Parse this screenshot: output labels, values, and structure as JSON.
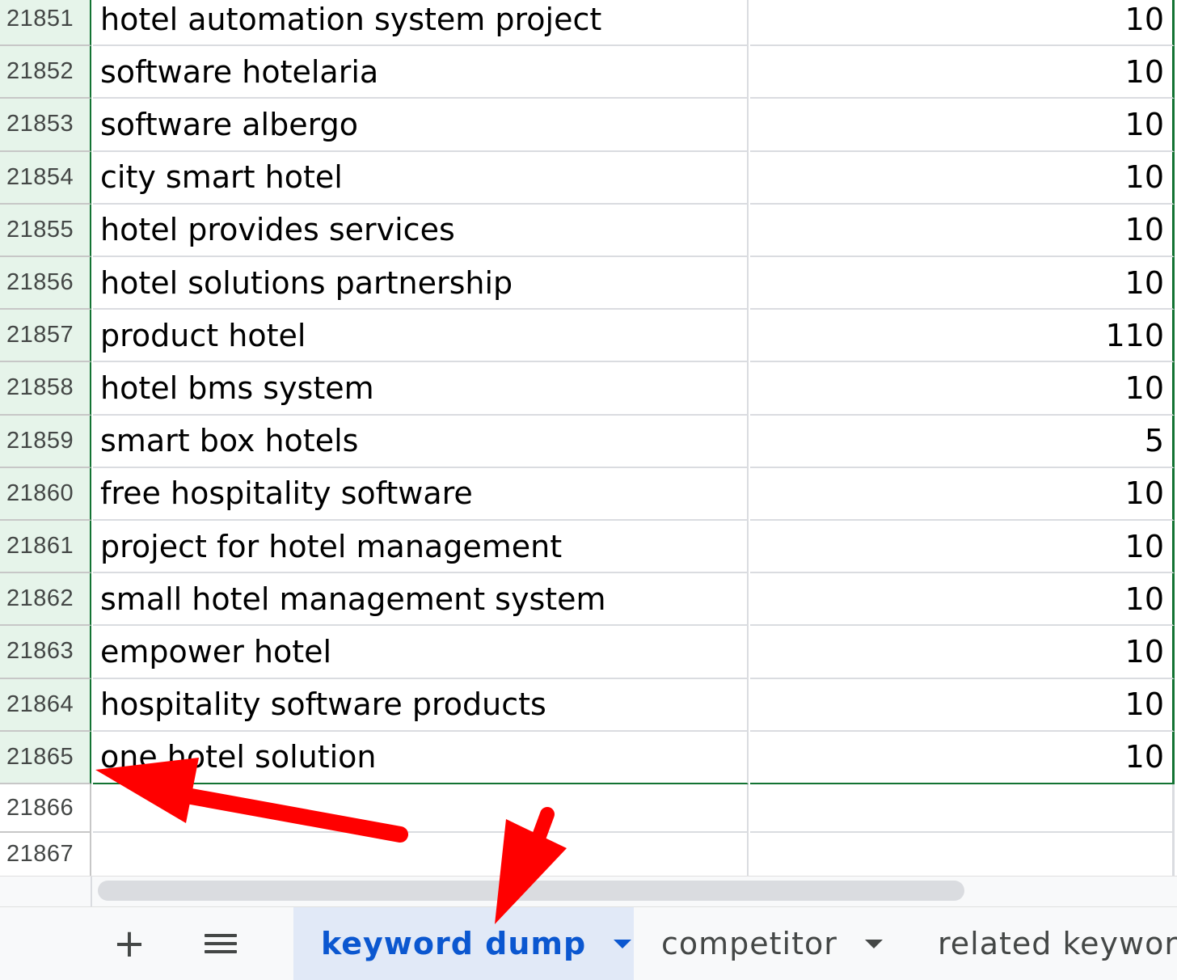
{
  "rows": [
    {
      "num": "21851",
      "keyword": "hotel automation system project",
      "value": "10"
    },
    {
      "num": "21852",
      "keyword": "software hotelaria",
      "value": "10"
    },
    {
      "num": "21853",
      "keyword": "software albergo",
      "value": "10"
    },
    {
      "num": "21854",
      "keyword": "city smart hotel",
      "value": "10"
    },
    {
      "num": "21855",
      "keyword": "hotel provides services",
      "value": "10"
    },
    {
      "num": "21856",
      "keyword": "hotel solutions partnership",
      "value": "10"
    },
    {
      "num": "21857",
      "keyword": "product hotel",
      "value": "110"
    },
    {
      "num": "21858",
      "keyword": "hotel bms system",
      "value": "10"
    },
    {
      "num": "21859",
      "keyword": "smart box hotels",
      "value": "5"
    },
    {
      "num": "21860",
      "keyword": "free hospitality software",
      "value": "10"
    },
    {
      "num": "21861",
      "keyword": "project for hotel management",
      "value": "10"
    },
    {
      "num": "21862",
      "keyword": "small hotel management system",
      "value": "10"
    },
    {
      "num": "21863",
      "keyword": "empower hotel",
      "value": "10"
    },
    {
      "num": "21864",
      "keyword": "hospitality software products",
      "value": "10"
    },
    {
      "num": "21865",
      "keyword": "one hotel solution",
      "value": "10"
    },
    {
      "num": "21866",
      "keyword": "",
      "value": ""
    },
    {
      "num": "21867",
      "keyword": "",
      "value": ""
    }
  ],
  "toolbar": {
    "add_label": "+"
  },
  "tabs": [
    {
      "label": "keyword dump",
      "active": true
    },
    {
      "label": "competitor",
      "active": false
    },
    {
      "label": "related keywor",
      "active": false
    }
  ],
  "colors": {
    "selection": "#137333",
    "selected_row_header": "#e6f4ea",
    "active_tab_bg": "#e1e9f7",
    "active_tab_text": "#0b57d0",
    "annotation_arrow": "#ff0000"
  }
}
